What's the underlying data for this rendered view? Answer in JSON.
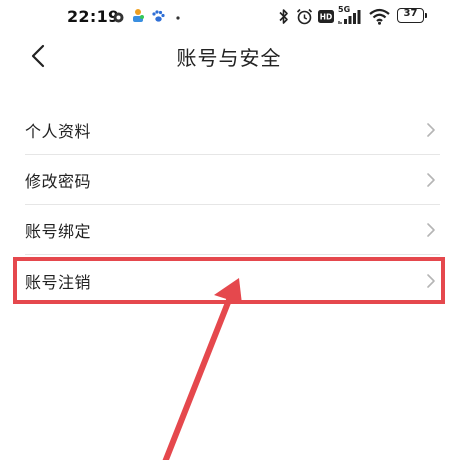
{
  "status_bar": {
    "time": "22:19",
    "network": "5G",
    "battery": "37"
  },
  "nav": {
    "title": "账号与安全"
  },
  "menu": {
    "items": [
      {
        "label": "个人资料"
      },
      {
        "label": "修改密码"
      },
      {
        "label": "账号绑定"
      },
      {
        "label": "账号注销"
      }
    ]
  },
  "colors": {
    "annotation": "#e5484d",
    "chevron": "#b5b5b5",
    "divider": "#e6e6e6"
  },
  "icons": {
    "back": "chevron-left-icon",
    "row": "chevron-right-icon"
  }
}
